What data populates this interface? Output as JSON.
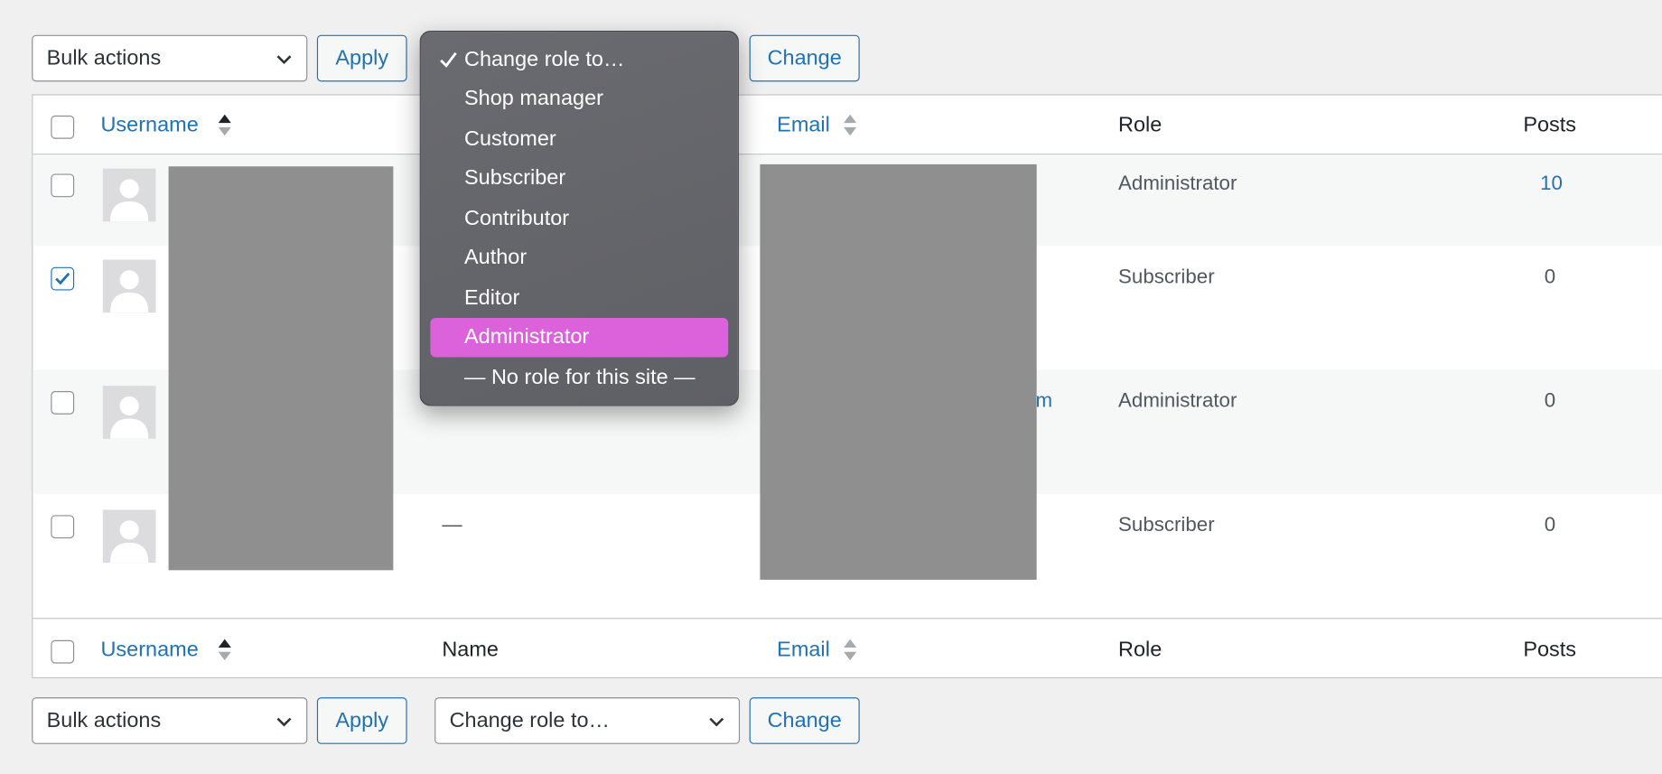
{
  "top_bar": {
    "bulk_actions": "Bulk actions",
    "apply": "Apply",
    "change": "Change"
  },
  "table": {
    "headers": {
      "username": "Username",
      "name": "Name",
      "email": "Email",
      "role": "Role",
      "posts": "Posts"
    },
    "rows": [
      {
        "checked": false,
        "name": "",
        "email_fragment": "",
        "role": "Administrator",
        "posts": "10",
        "posts_is_link": true
      },
      {
        "checked": true,
        "name": "",
        "email_fragment": "",
        "role": "Subscriber",
        "posts": "0",
        "posts_is_link": false
      },
      {
        "checked": false,
        "name": "",
        "email_fragment": "m",
        "role": "Administrator",
        "posts": "0",
        "posts_is_link": false
      },
      {
        "checked": false,
        "name": "—",
        "email_fragment": "",
        "role": "Subscriber",
        "posts": "0",
        "posts_is_link": false
      }
    ]
  },
  "role_dropdown": {
    "options": [
      "Change role to…",
      "Shop manager",
      "Customer",
      "Subscriber",
      "Contributor",
      "Author",
      "Editor",
      "Administrator",
      "— No role for this site —"
    ],
    "checked_option": "Change role to…",
    "highlighted_option": "Administrator",
    "highlight_color": "#dc62dc"
  },
  "bottom_bar": {
    "bulk_actions": "Bulk actions",
    "apply": "Apply",
    "change_role": "Change role to…",
    "change": "Change"
  },
  "colors": {
    "link": "#2271b1",
    "background": "#f0f0f1"
  }
}
